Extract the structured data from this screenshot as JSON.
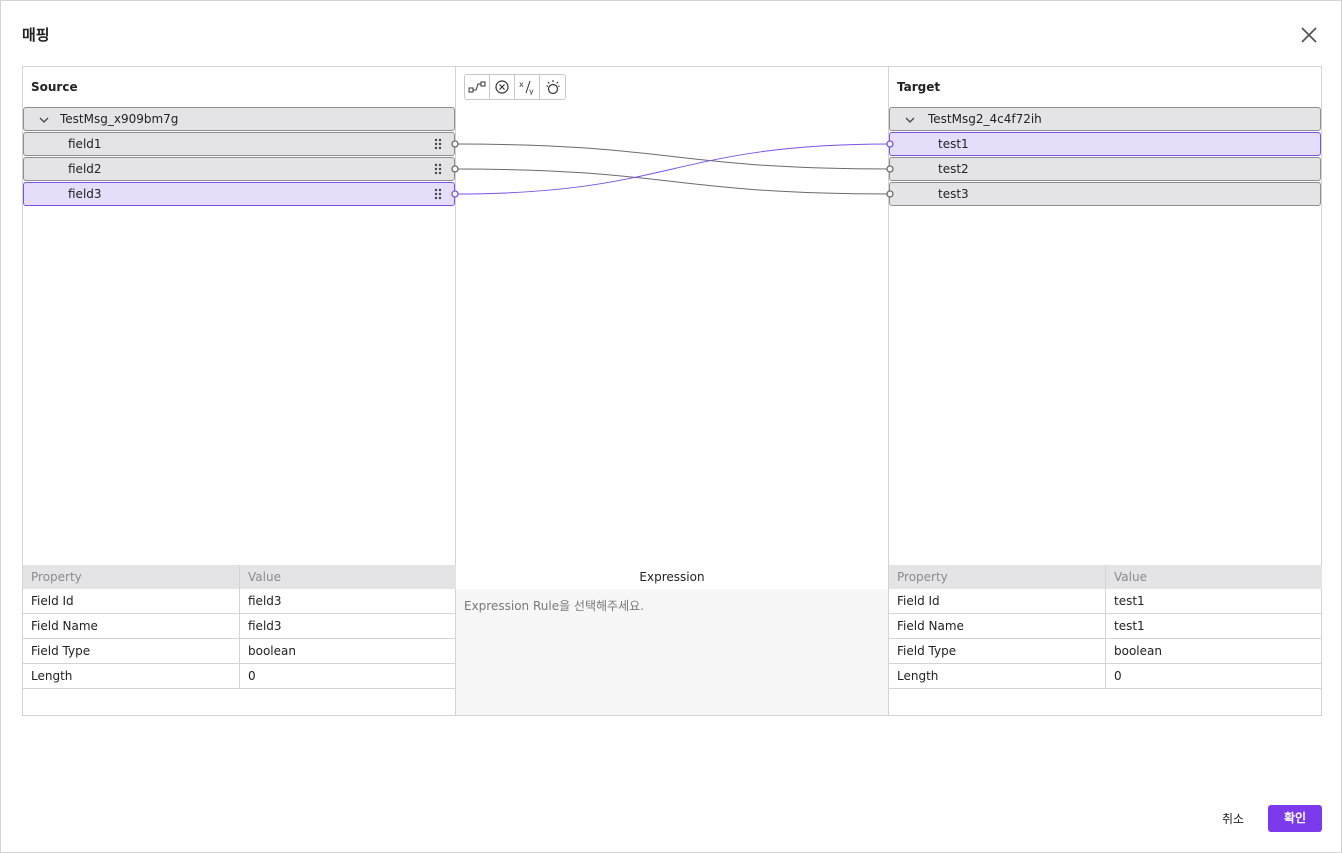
{
  "dialog": {
    "title": "매핑"
  },
  "source": {
    "header": "Source",
    "root": "TestMsg_x909bm7g",
    "fields": [
      {
        "label": "field1",
        "selected": false
      },
      {
        "label": "field2",
        "selected": false
      },
      {
        "label": "field3",
        "selected": true
      }
    ],
    "properties": {
      "col_property": "Property",
      "col_value": "Value",
      "rows": [
        {
          "name": "Field Id",
          "value": "field3"
        },
        {
          "name": "Field Name",
          "value": "field3"
        },
        {
          "name": "Field Type",
          "value": "boolean"
        },
        {
          "name": "Length",
          "value": "0"
        }
      ]
    }
  },
  "target": {
    "header": "Target",
    "root": "TestMsg2_4c4f72ih",
    "fields": [
      {
        "label": "test1",
        "selected": true
      },
      {
        "label": "test2",
        "selected": false
      },
      {
        "label": "test3",
        "selected": false
      }
    ],
    "properties": {
      "col_property": "Property",
      "col_value": "Value",
      "rows": [
        {
          "name": "Field Id",
          "value": "test1"
        },
        {
          "name": "Field Name",
          "value": "test1"
        },
        {
          "name": "Field Type",
          "value": "boolean"
        },
        {
          "name": "Length",
          "value": "0"
        }
      ]
    }
  },
  "toolbar": {
    "icons": [
      "connect-icon",
      "clear-icon",
      "divide-icon",
      "bulb-icon"
    ]
  },
  "expression": {
    "header": "Expression",
    "placeholder": "Expression Rule을 선택해주세요."
  },
  "mappings": [
    {
      "source": "field1",
      "target": "test2",
      "selected": false
    },
    {
      "source": "field2",
      "target": "test3",
      "selected": false
    },
    {
      "source": "field3",
      "target": "test1",
      "selected": true
    }
  ],
  "footer": {
    "cancel": "취소",
    "ok": "확인"
  },
  "colors": {
    "accent": "#7c3aed",
    "selected_bg": "#e6ddfb",
    "link": "#6b6b70",
    "link_selected": "#7c52e6"
  }
}
